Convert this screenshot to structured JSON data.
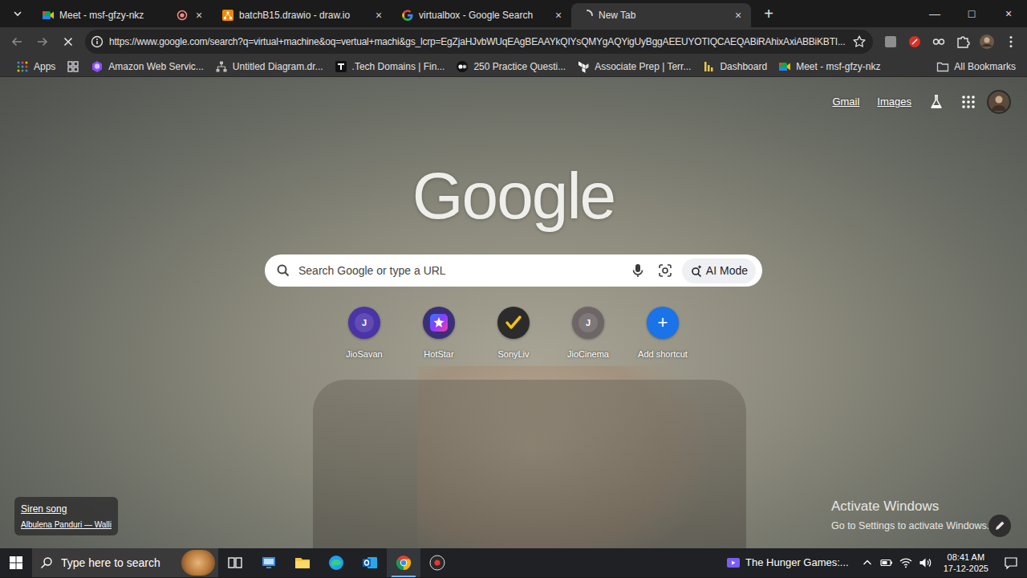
{
  "window": {
    "controls": [
      "—",
      "□",
      "×"
    ]
  },
  "tabs": [
    {
      "label": "Meet - msf-gfzy-nkz",
      "kind": "meet",
      "recording": true,
      "selected": false,
      "close": "×"
    },
    {
      "label": "batchB15.drawio - draw.io",
      "kind": "drawio",
      "recording": false,
      "selected": false,
      "close": "×"
    },
    {
      "label": "virtualbox - Google Search",
      "kind": "google",
      "recording": false,
      "selected": false,
      "close": "×"
    },
    {
      "label": "New Tab",
      "kind": "loading",
      "recording": false,
      "selected": true,
      "close": "×"
    }
  ],
  "new_tab": "+",
  "toolbar": {
    "url": "https://www.google.com/search?q=virtual+machine&oq=vertual+machi&gs_lcrp=EgZjaHJvbWUqEAgBEAAYkQIYsQMYgAQYigUyBggAEEUYOTIQCAEQABiRAhixAxiABBiKBTI..."
  },
  "bookmarks": {
    "apps": "Apps",
    "items": [
      {
        "label": "Amazon Web Servic...",
        "kind": "aws"
      },
      {
        "label": "Untitled Diagram.dr...",
        "kind": "diagram"
      },
      {
        "label": ".Tech Domains | Fin...",
        "kind": "tech"
      },
      {
        "label": "250 Practice Questi...",
        "kind": "medium"
      },
      {
        "label": "Associate Prep | Terr...",
        "kind": "terraform"
      },
      {
        "label": "Dashboard",
        "kind": "dashboard"
      },
      {
        "label": "Meet - msf-gfzy-nkz",
        "kind": "meet"
      }
    ],
    "all": "All Bookmarks"
  },
  "ntp": {
    "links": [
      "Gmail",
      "Images"
    ],
    "logo": "Google",
    "search": {
      "placeholder": "Search Google or type a URL",
      "ai_mode": "AI Mode"
    },
    "shortcuts": [
      {
        "label": "JioSavan",
        "kind": "letter",
        "glyph": "J",
        "color": "#4a34a8"
      },
      {
        "label": "HotStar",
        "kind": "hotstar",
        "color": "#3b2f7a"
      },
      {
        "label": "SonyLiv",
        "kind": "sonyliv",
        "color": "#2b2b2b"
      },
      {
        "label": "JioCinema",
        "kind": "letter",
        "glyph": "J",
        "color": "#6e6666"
      },
      {
        "label": "Add shortcut",
        "kind": "add",
        "glyph": "+",
        "color": "#1a73e8"
      }
    ],
    "media": {
      "title": "Siren song",
      "artist": "Albulena Panduri — Walli"
    }
  },
  "watermark": {
    "title": "Activate Windows",
    "subtitle": "Go to Settings to activate Windows."
  },
  "taskbar": {
    "search_placeholder": "Type here to search",
    "apps": [
      {
        "kind": "taskview",
        "selected": false
      },
      {
        "kind": "remote",
        "selected": false
      },
      {
        "kind": "explorer",
        "selected": false
      },
      {
        "kind": "edge",
        "selected": false
      },
      {
        "kind": "outlook",
        "selected": false
      },
      {
        "kind": "chrome",
        "selected": true
      },
      {
        "kind": "obs",
        "selected": false
      }
    ],
    "widget": "The Hunger Games:...",
    "time": "08:41 AM",
    "date": "17-12-2025"
  }
}
